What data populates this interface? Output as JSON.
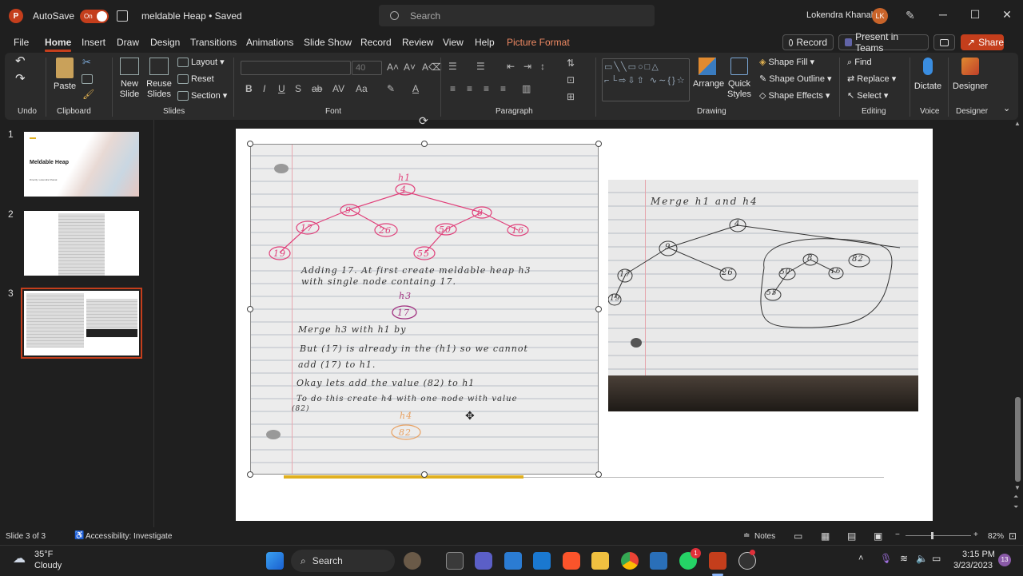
{
  "titlebar": {
    "app_logo": "P",
    "autosave_label": "AutoSave",
    "autosave_state": "On",
    "document_title": "meldable Heap • Saved",
    "search_placeholder": "Search",
    "user_name": "Lokendra Khanal",
    "user_initials": "LK"
  },
  "menu": {
    "items": [
      "File",
      "Home",
      "Insert",
      "Draw",
      "Design",
      "Transitions",
      "Animations",
      "Slide Show",
      "Record",
      "Review",
      "View",
      "Help",
      "Picture Format"
    ],
    "active": "Home",
    "record_btn": "Record",
    "teams_btn": "Present in Teams",
    "share_btn": "Share"
  },
  "ribbon": {
    "groups": {
      "undo": "Undo",
      "clipboard": "Clipboard",
      "slides": "Slides",
      "font": "Font",
      "paragraph": "Paragraph",
      "drawing": "Drawing",
      "editing": "Editing",
      "voice": "Voice",
      "designer": "Designer"
    },
    "paste": "Paste",
    "new_slide_1": "New",
    "new_slide_2": "Slide",
    "reuse_1": "Reuse",
    "reuse_2": "Slides",
    "layout": "Layout",
    "reset": "Reset",
    "section": "Section",
    "font_size": "40",
    "arrange": "Arrange",
    "quick_styles_1": "Quick",
    "quick_styles_2": "Styles",
    "shape_fill": "Shape Fill",
    "shape_outline": "Shape Outline",
    "shape_effects": "Shape Effects",
    "find": "Find",
    "replace": "Replace",
    "select": "Select",
    "dictate": "Dictate",
    "designer": "Designer"
  },
  "slides_panel": {
    "slides": [
      {
        "num": "1",
        "title": "Meldable Heap",
        "subtitle": "Directly: Lokendra Khanal"
      },
      {
        "num": "2"
      },
      {
        "num": "3"
      }
    ]
  },
  "slide": {
    "notebook1": {
      "tree_label": "h1",
      "nodes": [
        "4",
        "9",
        "8",
        "17",
        "26",
        "50",
        "16",
        "19",
        "55"
      ],
      "line1": "Adding 17. At first create meldable heap h3",
      "line2": "with single node containg 17.",
      "h3_label": "h3",
      "h3_node": "17",
      "line3": "Merge h3 with h1 by",
      "line4": "But (17) is already in the (h1) so we cannot",
      "line5": "add (17) to h1.",
      "line6": "Okay lets add the value (82) to h1",
      "line7": "To do this create h4 with one node with value",
      "line8": "(82)",
      "h4_label": "h4",
      "h4_node": "82"
    },
    "notebook2": {
      "heading": "Merge h1 and h4",
      "nodes": [
        "4",
        "9",
        "26",
        "17",
        "19",
        "8",
        "82",
        "50",
        "16",
        "55"
      ]
    }
  },
  "statusbar": {
    "slide_info": "Slide 3 of 3",
    "accessibility": "Accessibility: Investigate",
    "notes": "Notes",
    "zoom": "82%"
  },
  "taskbar": {
    "weather_temp": "35°F",
    "weather_desc": "Cloudy",
    "search_label": "Search",
    "time": "3:15 PM",
    "date": "3/23/2023",
    "whatsapp_badge": "1",
    "notif_badge": "13"
  },
  "colors": {
    "accent": "#c43e1c",
    "tree_pink": "#e0407a",
    "h3_purple": "#a0307f",
    "h4_orange": "#e8a060"
  }
}
